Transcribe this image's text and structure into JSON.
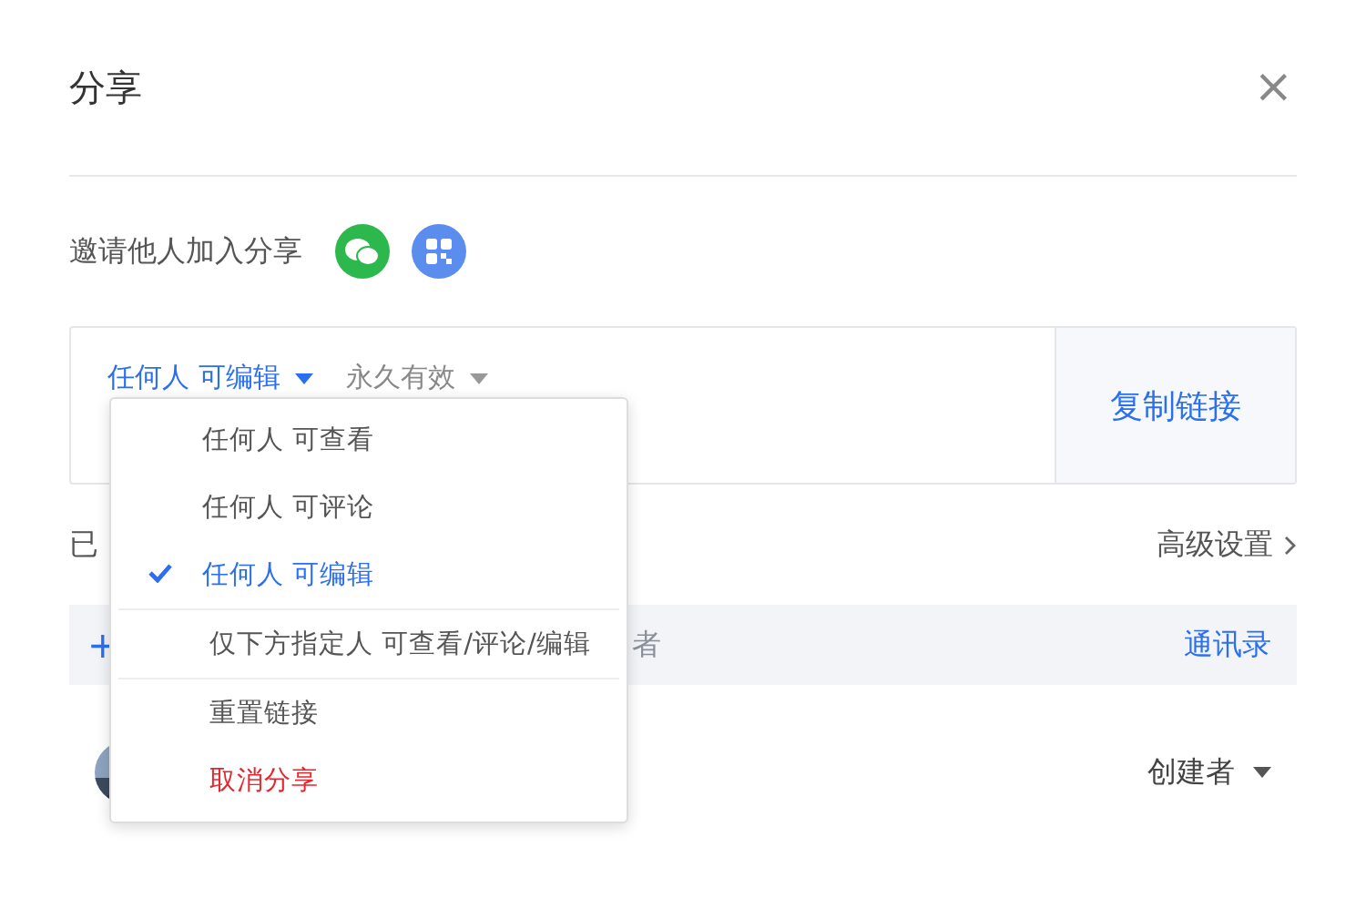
{
  "dialog": {
    "title": "分享",
    "close": "×"
  },
  "invite": {
    "label": "邀请他人加入分享"
  },
  "link": {
    "permission": "任何人 可编辑",
    "expiry": "永久有效",
    "copy_button": "复制链接"
  },
  "members": {
    "heading": "已",
    "advanced": "高级设置",
    "add_row": {
      "plus": "+",
      "placeholder": "者",
      "contacts": "通讯录"
    },
    "rows": [
      {
        "role": "创建者"
      }
    ]
  },
  "permission_menu": {
    "groups": [
      {
        "items": [
          {
            "label": "任何人 可查看",
            "selected": false,
            "kind": "normal"
          },
          {
            "label": "任何人 可评论",
            "selected": false,
            "kind": "normal"
          },
          {
            "label": "任何人 可编辑",
            "selected": true,
            "kind": "normal"
          }
        ]
      },
      {
        "items": [
          {
            "label": "仅下方指定人 可查看/评论/编辑",
            "selected": false,
            "kind": "normal"
          }
        ]
      },
      {
        "items": [
          {
            "label": "重置链接",
            "selected": false,
            "kind": "normal"
          },
          {
            "label": "取消分享",
            "selected": false,
            "kind": "danger"
          }
        ]
      }
    ]
  }
}
